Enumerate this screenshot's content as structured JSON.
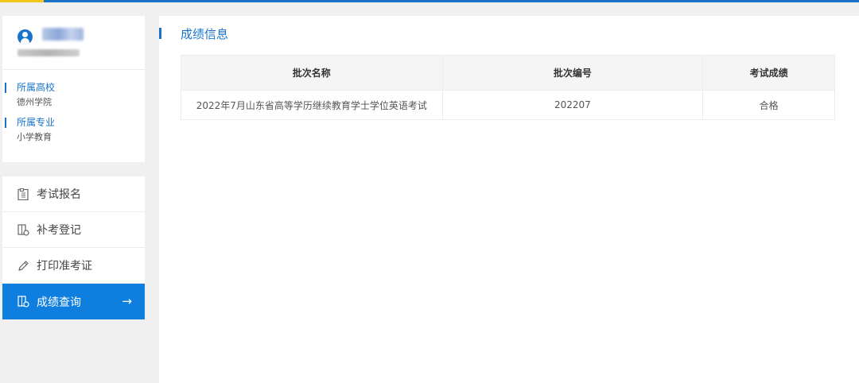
{
  "colors": {
    "accent": "#1a73c8",
    "active_menu": "#0e7fdf",
    "top_accent": "#f5c518"
  },
  "profile": {
    "name": "",
    "id_text": "",
    "school_label": "所属高校",
    "school_value": "德州学院",
    "major_label": "所属专业",
    "major_value": "小学教育"
  },
  "menu": {
    "items": [
      {
        "label": "考试报名",
        "icon": "registration-clipboard-icon"
      },
      {
        "label": "补考登记",
        "icon": "retake-record-icon"
      },
      {
        "label": "打印准考证",
        "icon": "pencil-icon"
      },
      {
        "label": "成绩查询",
        "icon": "score-query-icon",
        "active": true,
        "arrow": "→"
      }
    ]
  },
  "main": {
    "title": "成绩信息",
    "table": {
      "headers": [
        "批次名称",
        "批次编号",
        "考试成绩"
      ],
      "rows": [
        [
          "2022年7月山东省高等学历继续教育学士学位英语考试",
          "202207",
          "合格"
        ]
      ]
    }
  }
}
